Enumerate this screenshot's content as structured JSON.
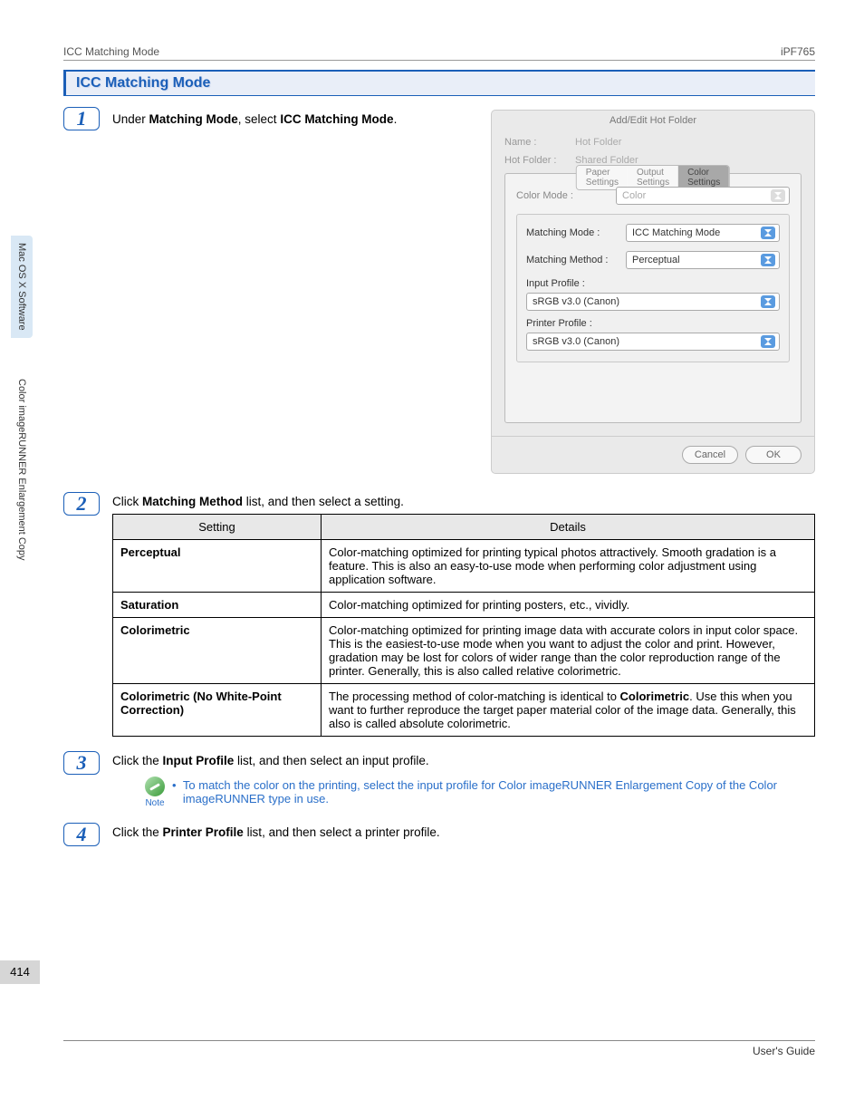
{
  "header": {
    "left": "ICC Matching Mode",
    "right": "iPF765"
  },
  "sidebar": {
    "top_tab": "Mac OS X Software",
    "bottom_tab": "Color imageRUNNER Enlargement Copy"
  },
  "section_title": "ICC Matching Mode",
  "step1": {
    "text_prefix": "Under ",
    "bold1": "Matching Mode",
    "mid": ", select ",
    "bold2": "ICC Matching Mode",
    "suffix": "."
  },
  "dialog": {
    "title": "Add/Edit Hot Folder",
    "name_label": "Name :",
    "name_value": "Hot Folder",
    "hotfolder_label": "Hot Folder :",
    "hotfolder_value": "Shared Folder",
    "tabs": {
      "paper": "Paper Settings",
      "output": "Output Settings",
      "color": "Color Settings"
    },
    "color_mode_label": "Color Mode :",
    "color_mode_value": "Color",
    "matching_mode_label": "Matching Mode :",
    "matching_mode_value": "ICC Matching Mode",
    "matching_method_label": "Matching Method :",
    "matching_method_value": "Perceptual",
    "input_profile_label": "Input Profile :",
    "input_profile_value": "sRGB v3.0 (Canon)",
    "printer_profile_label": "Printer Profile :",
    "printer_profile_value": "sRGB v3.0 (Canon)",
    "cancel": "Cancel",
    "ok": "OK"
  },
  "step2": {
    "text_prefix": "Click ",
    "bold1": "Matching Method",
    "suffix": " list, and then select a setting.",
    "th_setting": "Setting",
    "th_details": "Details",
    "rows": [
      {
        "setting": "Perceptual",
        "details": "Color-matching optimized for printing typical photos attractively. Smooth gradation is a feature. This is also an easy-to-use mode when performing color adjustment using application software."
      },
      {
        "setting": "Saturation",
        "details": "Color-matching optimized for printing posters, etc., vividly."
      },
      {
        "setting": "Colorimetric",
        "details": "Color-matching optimized for printing image data with accurate colors in input color space. This is the easiest-to-use mode when you want to adjust the color and print. However, gradation may be lost for colors of wider range than the color reproduction range of the printer. Generally, this is also called relative colorimetric."
      },
      {
        "setting": "Colorimetric (No White-Point Correction)",
        "details_pre": "The processing method of color-matching is identical to ",
        "details_bold": "Colorimetric",
        "details_post": ". Use this when you want to further reproduce the target paper material color of the image data. Generally, this also is called absolute colorimetric."
      }
    ]
  },
  "step3": {
    "text_prefix": "Click the ",
    "bold1": "Input Profile",
    "suffix": " list, and then select an input profile.",
    "note_label": "Note",
    "note_text": "To match the color on the printing, select the input profile for Color imageRUNNER Enlargement Copy of the Color imageRUNNER type in use."
  },
  "step4": {
    "text_prefix": "Click the ",
    "bold1": "Printer Profile",
    "suffix": " list, and then select a printer profile."
  },
  "page_number": "414",
  "footer": "User's Guide"
}
